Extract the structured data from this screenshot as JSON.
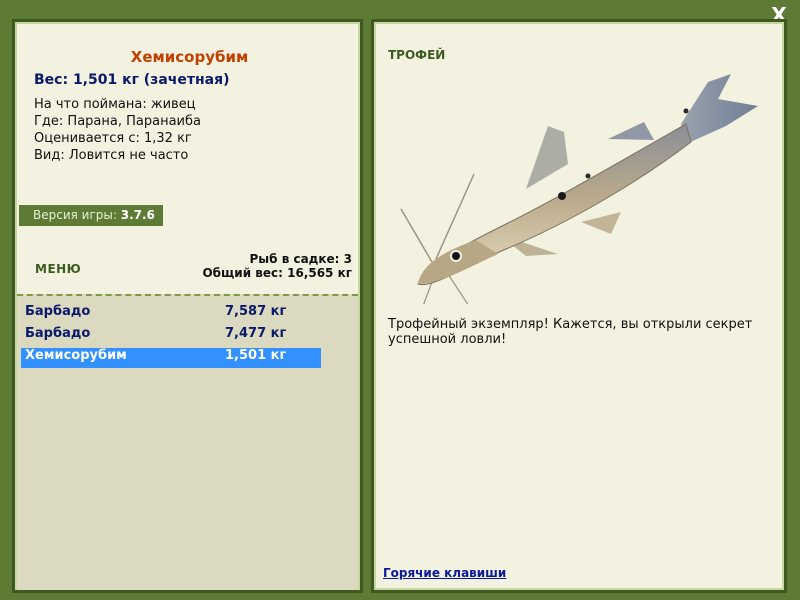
{
  "close_label": "X",
  "fish": {
    "name": "Хемисорубим",
    "weight": "Вес: 1,501 кг (зачетная)",
    "info": [
      "На что поймана: живец",
      "Где: Парана, Паранаиба",
      "Оценивается с: 1,32 кг",
      "Вид: Ловится не часто"
    ]
  },
  "version": {
    "label": "Версия игры:",
    "value": "3.7.6"
  },
  "menu_label": "МЕНЮ",
  "cage": {
    "count": "Рыб в садке: 3",
    "total": "Общий вес: 16,565 кг"
  },
  "catch_list": [
    {
      "name": "Барбадо",
      "weight": "7,587 кг",
      "selected": false
    },
    {
      "name": "Барбадо",
      "weight": "7,477 кг",
      "selected": false
    },
    {
      "name": "Хемисорубим",
      "weight": "1,501 кг",
      "selected": true
    }
  ],
  "trophy": {
    "label": "ТРОФЕЙ",
    "text": "Трофейный экземпляр! Кажется, вы открыли секрет успешной ловли!"
  },
  "hotkeys_label": "Горячие клавиши",
  "colors": {
    "frame": "#5d7b35",
    "panel": "#f3f1e0",
    "list_bg": "#dcd9c1",
    "selection": "#3390ff",
    "title": "#c04000",
    "accent_text": "#0a1a6a"
  }
}
